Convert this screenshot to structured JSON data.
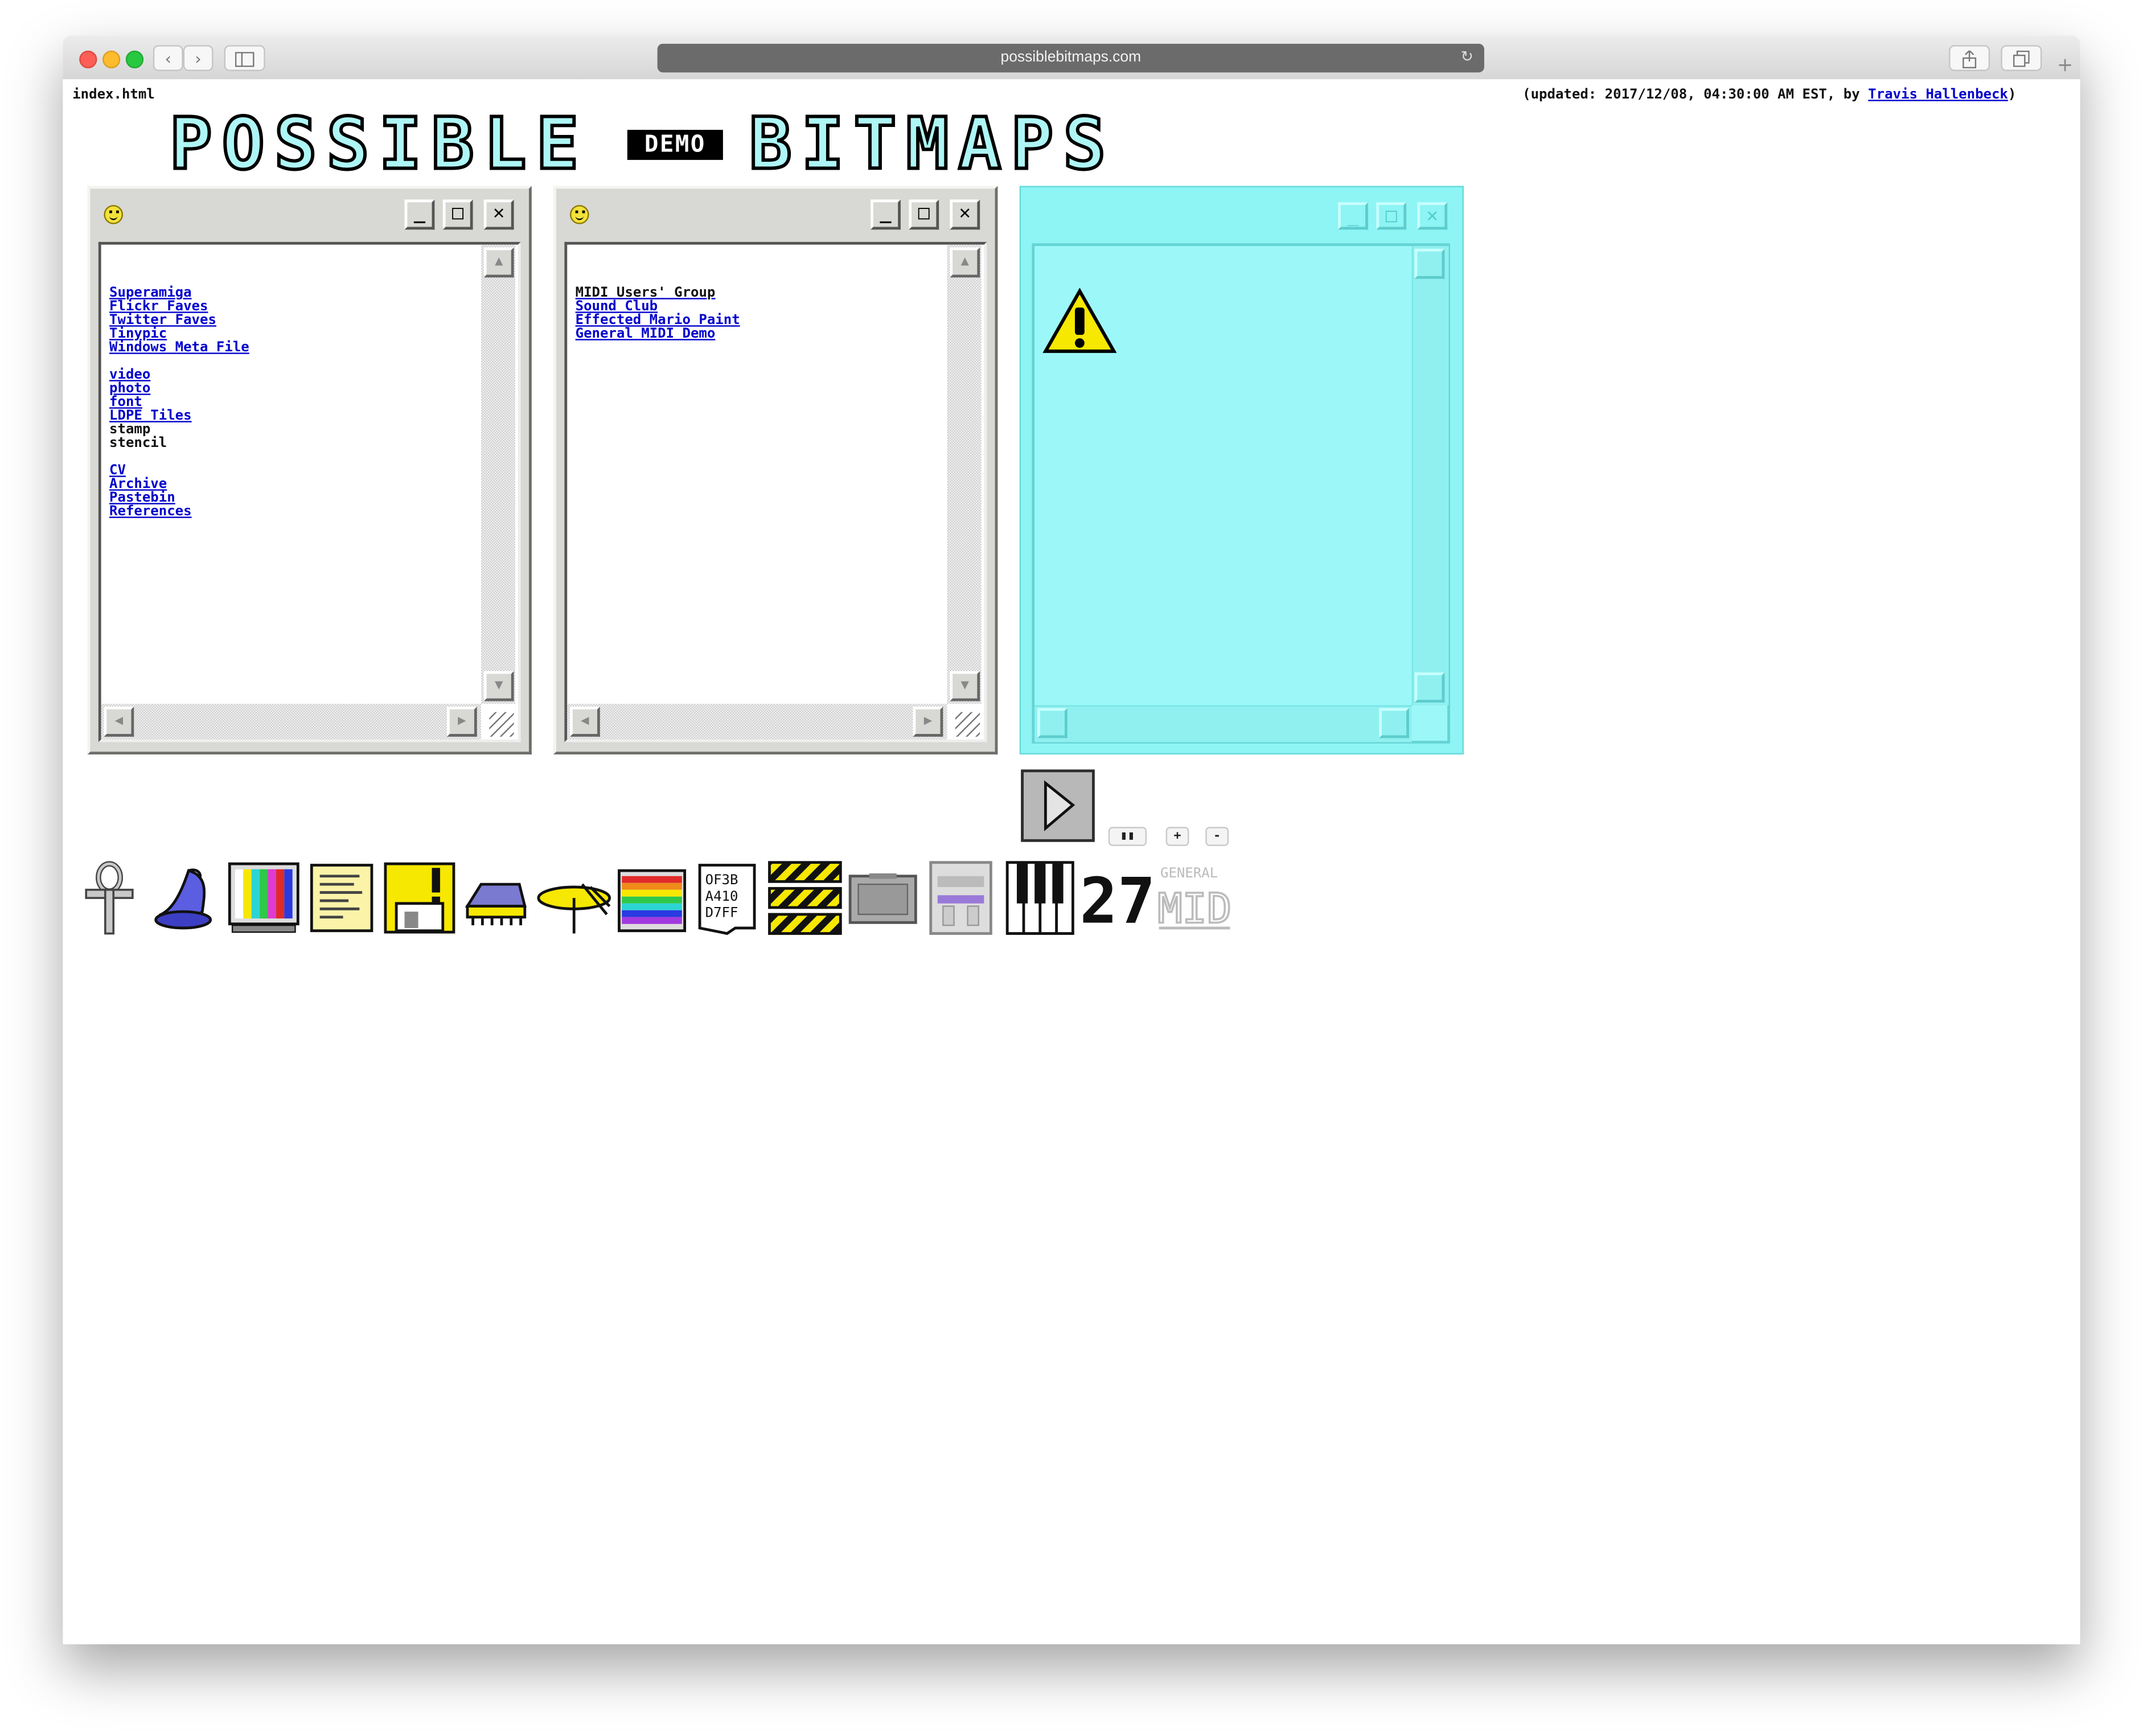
{
  "browser": {
    "url": "possiblebitmaps.com",
    "back_icon": "chevron-left-icon",
    "forward_icon": "chevron-right-icon",
    "sidebar_icon": "sidebar-icon",
    "reload_icon": "reload-icon",
    "share_icon": "share-icon",
    "tabs_icon": "tabs-icon",
    "new_tab_icon": "plus-icon"
  },
  "header": {
    "filename": "index.html",
    "updated_prefix": "(updated: 2017/12/08, 04:30:00 AM EST, by ",
    "author": "Travis Hallenbeck",
    "updated_suffix": ")"
  },
  "logo": {
    "word1": "POSSIBLE",
    "badge": "DEMO",
    "word2": "BITMAPS"
  },
  "window1": {
    "group1": [
      "Superamiga",
      "Flickr Faves",
      "Twitter Faves",
      "Tinypic",
      "Windows Meta File"
    ],
    "group2_links": [
      "video",
      "photo",
      "font",
      "LDPE Tiles"
    ],
    "group2_text": [
      "stamp",
      "stencil"
    ],
    "group3": [
      "CV",
      "Archive",
      "Pastebin",
      "References"
    ]
  },
  "window2": {
    "midi_words": [
      "MIDI",
      "Users'",
      "Group"
    ],
    "links": [
      "Sound Club",
      "Effected Mario Paint",
      "General MIDI Demo"
    ]
  },
  "window_buttons": {
    "minimize": "_",
    "maximize": "□",
    "close": "✕"
  },
  "player": {
    "play_icon": "play-icon",
    "pause_label": "▮▮",
    "plus_label": "+",
    "minus_label": "-"
  },
  "icons": [
    "ankh-icon",
    "wizard-hat-icon",
    "color-bars-tv-icon",
    "notepad-icon",
    "floppy-disk-icon",
    "rom-chip-icon",
    "cymbal-icon",
    "rainbow-stack-icon",
    "hex-code-icon",
    "caution-stripes-icon",
    "cartridge-icon",
    "console-icon",
    "piano-keys-icon",
    "digital-number-icon",
    "general-midi-logo"
  ],
  "hex_lines": [
    "OF3B",
    "A410",
    "D7FF"
  ],
  "digits": "27",
  "midi_logo": {
    "top": "GENERAL",
    "bottom": "MIDI"
  },
  "colors": {
    "logo_fill": "#aef6f6",
    "window_gray": "#d8d8d4",
    "cyan_window": "#8ef4f4",
    "link": "#0000cc",
    "warning": "#f6e800"
  }
}
